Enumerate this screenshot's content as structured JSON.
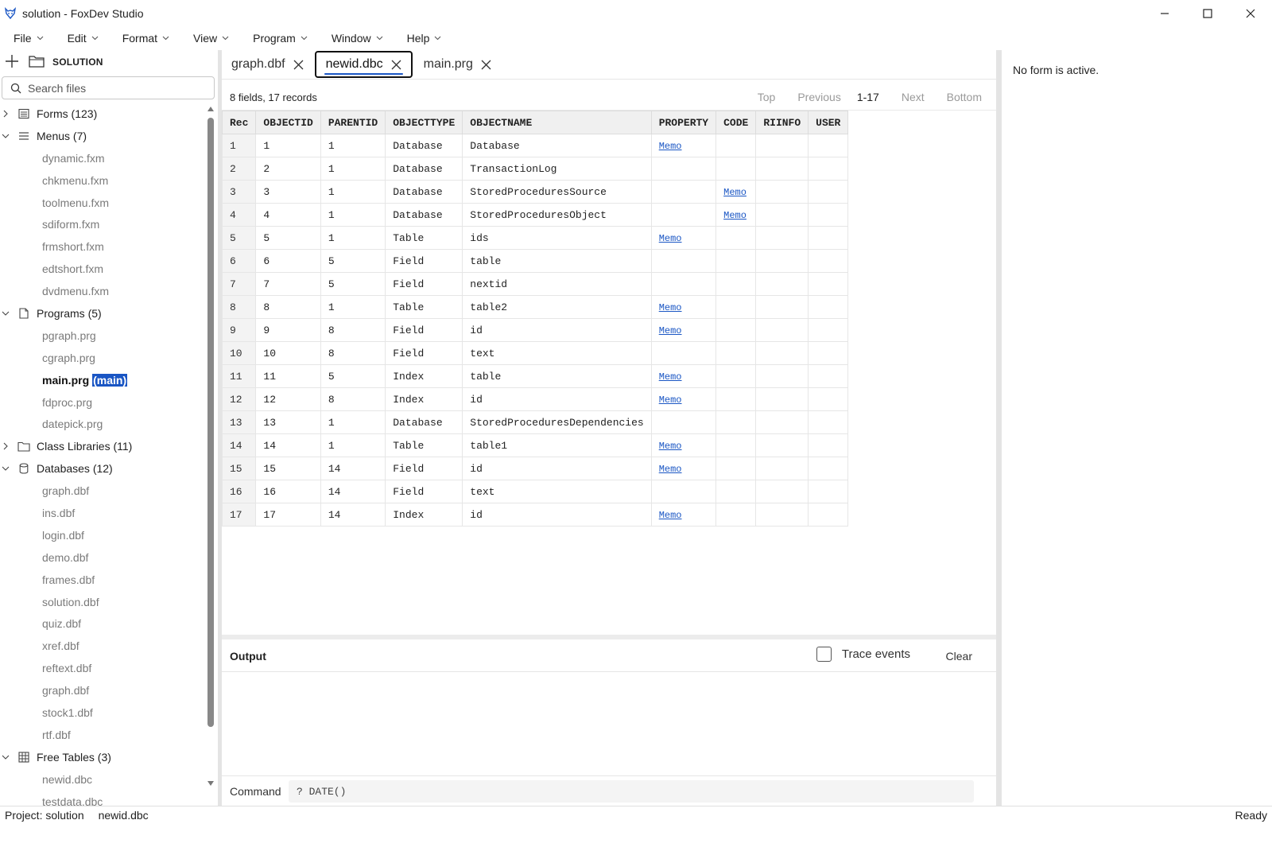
{
  "window": {
    "title": "solution - FoxDev Studio"
  },
  "menu": [
    "File",
    "Edit",
    "Format",
    "View",
    "Program",
    "Window",
    "Help"
  ],
  "sidebar": {
    "header_label": "SOLUTION",
    "search_placeholder": "Search files",
    "groups": [
      {
        "label": "Forms (123)",
        "expanded": false,
        "icon": "form-icon",
        "items": []
      },
      {
        "label": "Menus (7)",
        "expanded": true,
        "icon": "menu-list-icon",
        "items": [
          "dynamic.fxm",
          "chkmenu.fxm",
          "toolmenu.fxm",
          "sdiform.fxm",
          "frmshort.fxm",
          "edtshort.fxm",
          "dvdmenu.fxm"
        ]
      },
      {
        "label": "Programs (5)",
        "expanded": true,
        "icon": "file-icon",
        "items": [
          "pgraph.prg",
          "cgraph.prg",
          "main.prg",
          "fdproc.prg",
          "datepick.prg"
        ]
      },
      {
        "label": "Class Libraries (11)",
        "expanded": false,
        "icon": "folder-icon",
        "items": []
      },
      {
        "label": "Databases (12)",
        "expanded": true,
        "icon": "database-icon",
        "items": [
          "graph.dbf",
          "ins.dbf",
          "login.dbf",
          "demo.dbf",
          "frames.dbf",
          "solution.dbf",
          "quiz.dbf",
          "xref.dbf",
          "reftext.dbf",
          "graph.dbf",
          "stock1.dbf",
          "rtf.dbf"
        ]
      },
      {
        "label": "Free Tables (3)",
        "expanded": true,
        "icon": "table-icon",
        "items": [
          "newid.dbc",
          "testdata.dbc"
        ]
      }
    ],
    "main_file": {
      "name": "main.prg",
      "tag_open": "(",
      "tag": "main",
      "tag_close": ")"
    }
  },
  "tabs": [
    {
      "label": "graph.dbf",
      "active": false
    },
    {
      "label": "newid.dbc",
      "active": true
    },
    {
      "label": "main.prg",
      "active": false
    }
  ],
  "grid": {
    "summary": "8 fields, 17 records",
    "pager": {
      "top": "Top",
      "previous": "Previous",
      "range": "1-17",
      "next": "Next",
      "bottom": "Bottom"
    },
    "columns": [
      "Rec",
      "OBJECTID",
      "PARENTID",
      "OBJECTTYPE",
      "OBJECTNAME",
      "PROPERTY",
      "CODE",
      "RIINFO",
      "USER"
    ],
    "rows": [
      [
        "1",
        "1",
        "1",
        "Database",
        "Database",
        "Memo",
        "",
        "",
        ""
      ],
      [
        "2",
        "2",
        "1",
        "Database",
        "TransactionLog",
        "",
        "",
        "",
        ""
      ],
      [
        "3",
        "3",
        "1",
        "Database",
        "StoredProceduresSource",
        "",
        "Memo",
        "",
        ""
      ],
      [
        "4",
        "4",
        "1",
        "Database",
        "StoredProceduresObject",
        "",
        "Memo",
        "",
        ""
      ],
      [
        "5",
        "5",
        "1",
        "Table",
        "ids",
        "Memo",
        "",
        "",
        ""
      ],
      [
        "6",
        "6",
        "5",
        "Field",
        "table",
        "",
        "",
        "",
        ""
      ],
      [
        "7",
        "7",
        "5",
        "Field",
        "nextid",
        "",
        "",
        "",
        ""
      ],
      [
        "8",
        "8",
        "1",
        "Table",
        "table2",
        "Memo",
        "",
        "",
        ""
      ],
      [
        "9",
        "9",
        "8",
        "Field",
        "id",
        "Memo",
        "",
        "",
        ""
      ],
      [
        "10",
        "10",
        "8",
        "Field",
        "text",
        "",
        "",
        "",
        ""
      ],
      [
        "11",
        "11",
        "5",
        "Index",
        "table",
        "Memo",
        "",
        "",
        ""
      ],
      [
        "12",
        "12",
        "8",
        "Index",
        "id",
        "Memo",
        "",
        "",
        ""
      ],
      [
        "13",
        "13",
        "1",
        "Database",
        "StoredProceduresDependencies",
        "",
        "",
        "",
        ""
      ],
      [
        "14",
        "14",
        "1",
        "Table",
        "table1",
        "Memo",
        "",
        "",
        ""
      ],
      [
        "15",
        "15",
        "14",
        "Field",
        "id",
        "Memo",
        "",
        "",
        ""
      ],
      [
        "16",
        "16",
        "14",
        "Field",
        "text",
        "",
        "",
        "",
        ""
      ],
      [
        "17",
        "17",
        "14",
        "Index",
        "id",
        "Memo",
        "",
        "",
        ""
      ]
    ]
  },
  "output": {
    "title": "Output",
    "trace_label": "Trace events",
    "trace_checked": false,
    "clear_label": "Clear"
  },
  "command": {
    "label": "Command",
    "value": "? DATE()"
  },
  "right_panel": {
    "message": "No form is active."
  },
  "status": {
    "project": "Project: solution",
    "file": "newid.dbc",
    "state": "Ready"
  },
  "colors": {
    "accent": "#1a56c4",
    "link": "#1a56c4",
    "muted_text": "#7a7a7a"
  }
}
